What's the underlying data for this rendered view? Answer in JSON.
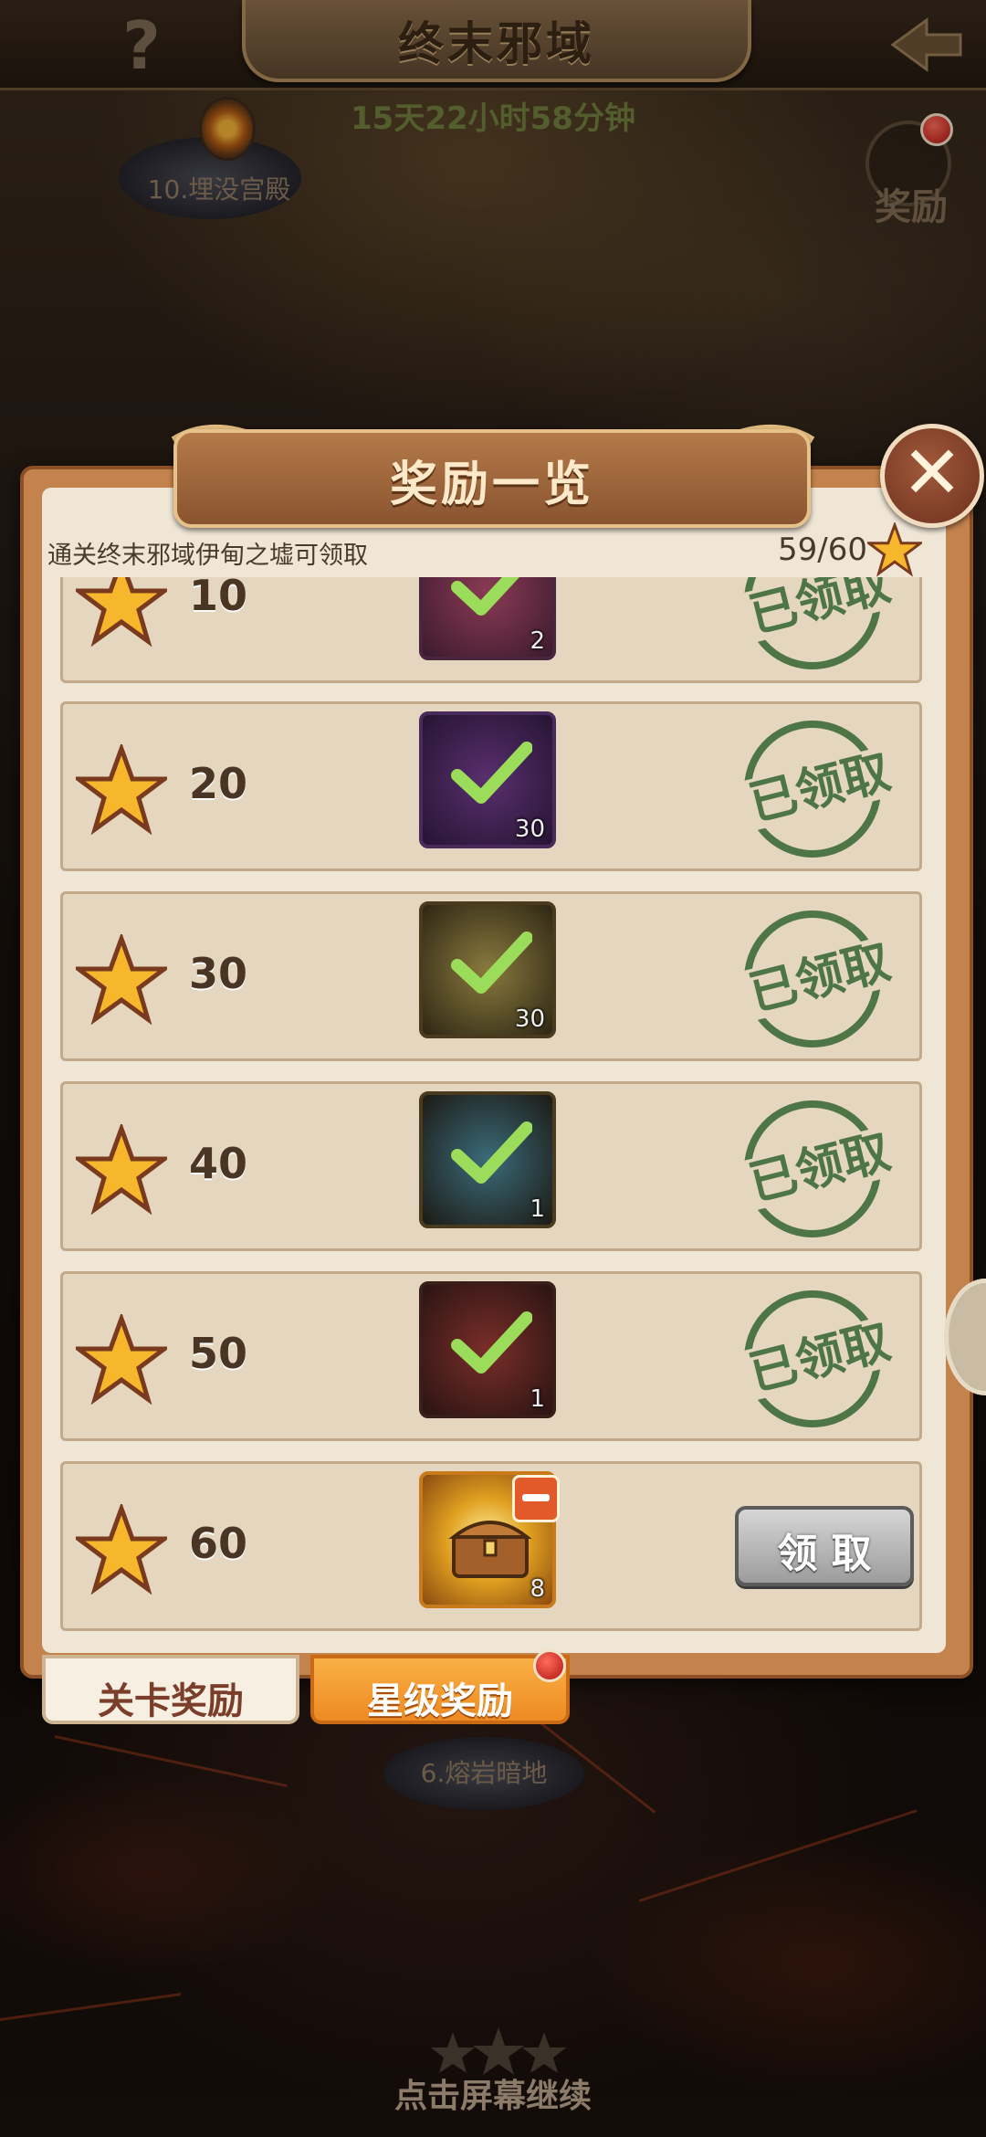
{
  "top_bar": {
    "help_label": "?",
    "title": "终末邪域"
  },
  "timer": "15天22小时58分钟",
  "map": {
    "node_top": "10.埋没宫殿",
    "node_bottom": "6.熔岩暗地",
    "reward_label": "奖励"
  },
  "modal": {
    "title": "奖励一览",
    "close_label": "✕",
    "description": "通关终末邪域伊甸之墟可领取",
    "progress": "59/60",
    "claimed_label": "已领取",
    "claim_label": "领 取",
    "rows": [
      {
        "stars": "10",
        "count": "2",
        "claimed": true
      },
      {
        "stars": "20",
        "count": "30",
        "claimed": true
      },
      {
        "stars": "30",
        "count": "30",
        "claimed": true
      },
      {
        "stars": "40",
        "count": "1",
        "claimed": true
      },
      {
        "stars": "50",
        "count": "1",
        "claimed": true
      },
      {
        "stars": "60",
        "count": "8",
        "claimed": false
      }
    ]
  },
  "tabs": {
    "stage_rewards": "关卡奖励",
    "star_rewards": "星级奖励"
  },
  "footer": {
    "continue_hint": "点击屏幕继续"
  },
  "colors": {
    "accent_orange": "#ee8a22",
    "stamp_green": "#3d6b38",
    "panel_bg": "#efe6d6"
  }
}
